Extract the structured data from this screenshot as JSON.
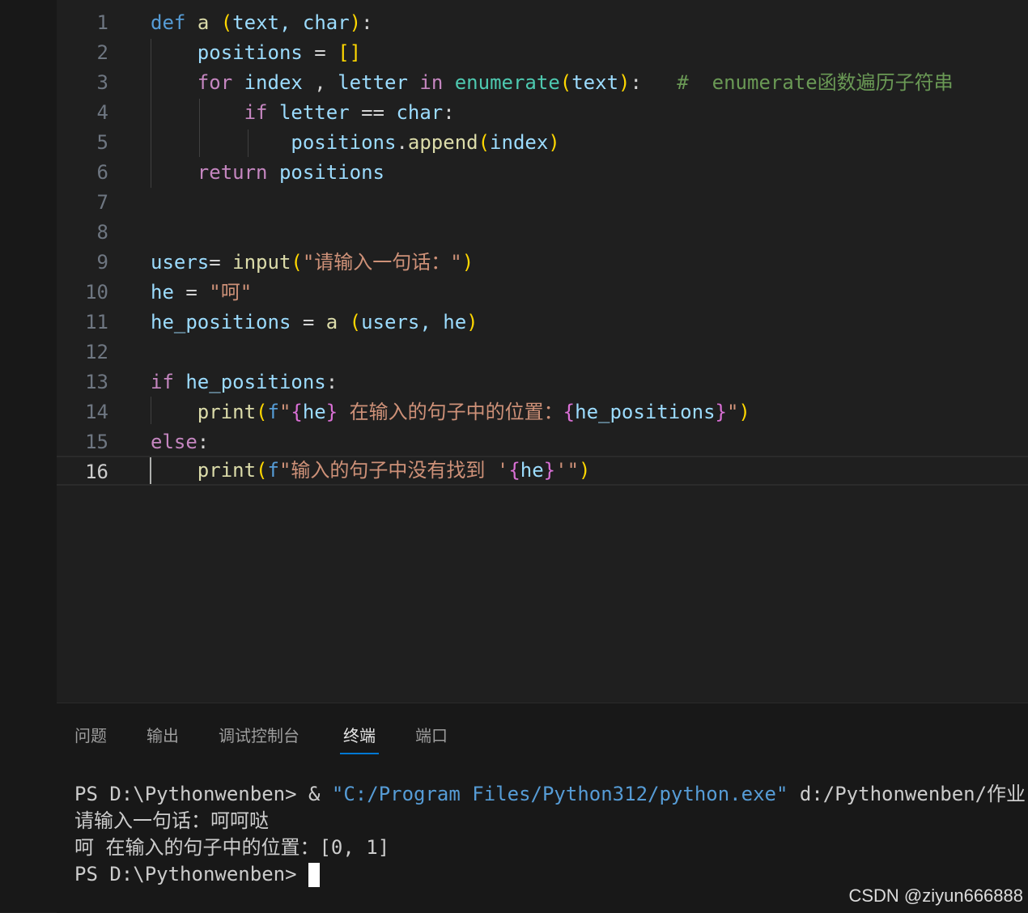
{
  "editor": {
    "line_numbers": [
      "1",
      "2",
      "3",
      "4",
      "5",
      "6",
      "7",
      "8",
      "9",
      "10",
      "11",
      "12",
      "13",
      "14",
      "15",
      "16"
    ],
    "active_line": "16"
  },
  "code": {
    "l1": {
      "kw": "def",
      "name": "a",
      "p1": "(",
      "args": "text, char",
      "p2": ")",
      "colon": ":"
    },
    "l2": {
      "var": "positions",
      "eq": " = ",
      "br": "[]"
    },
    "l3": {
      "kw": "for",
      "v1": "index",
      "sep": " , ",
      "v2": "letter",
      "in": "in",
      "fn": "enumerate",
      "p1": "(",
      "arg": "text",
      "p2": ")",
      "colon": ":",
      "cmt": "#  enumerate函数遍历子符串"
    },
    "l4": {
      "kw": "if",
      "v1": "letter",
      "op": " == ",
      "v2": "char",
      "colon": ":"
    },
    "l5": {
      "obj": "positions",
      "dot": ".",
      "fn": "append",
      "p1": "(",
      "arg": "index",
      "p2": ")"
    },
    "l6": {
      "kw": "return",
      "var": "positions"
    },
    "l9": {
      "var": "users",
      "eq": "= ",
      "fn": "input",
      "p1": "(",
      "str": "\"请输入一句话：\"",
      "p2": ")"
    },
    "l10": {
      "var": "he",
      "eq": " = ",
      "str": "\"呵\""
    },
    "l11": {
      "var": "he_positions",
      "eq": " = ",
      "fn": "a",
      "p1": "(",
      "args": "users, he",
      "p2": ")"
    },
    "l13": {
      "kw": "if",
      "var": "he_positions",
      "colon": ":"
    },
    "l14": {
      "fn": "print",
      "p1": "(",
      "f": "f",
      "q1": "\"",
      "b1": "{",
      "v1": "he",
      "b2": "}",
      "mid": " 在输入的句子中的位置：",
      "b3": "{",
      "v2": "he_positions",
      "b4": "}",
      "q2": "\"",
      "p2": ")"
    },
    "l15": {
      "kw": "else",
      "colon": ":"
    },
    "l16": {
      "fn": "print",
      "p1": "(",
      "f": "f",
      "s1": "\"输入的句子中没有找到 '",
      "b1": "{",
      "v": "he",
      "b2": "}",
      "s2": "'\"",
      "p2": ")"
    }
  },
  "panel": {
    "tabs": [
      "问题",
      "输出",
      "调试控制台",
      "终端",
      "端口"
    ],
    "active_tab": "终端"
  },
  "terminal": {
    "l1_prompt": "PS D:\\Pythonwenben> & ",
    "l1_str": "\"C:/Program Files/Python312/python.exe\"",
    "l1_rest": " d:/Pythonwenben/作业",
    "l2": "请输入一句话：呵呵哒",
    "l3": "呵 在输入的句子中的位置：[0, 1]",
    "l4_prompt": "PS D:\\Pythonwenben> "
  },
  "watermark": "CSDN @ziyun666888"
}
